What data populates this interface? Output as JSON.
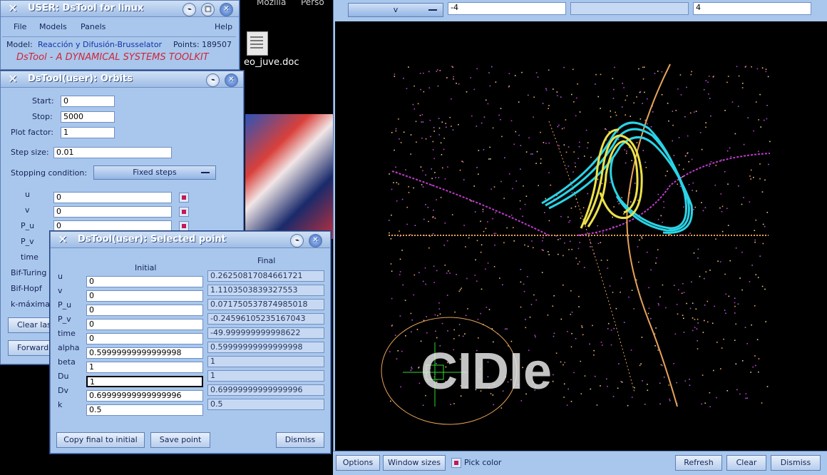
{
  "colors": {
    "window_bg": "#a9c7ec",
    "plot_bg": "#000000",
    "orbit_cyan": "#2ad4e6",
    "orbit_yellow": "#ece14a",
    "orbit_magenta": "#c23ad0",
    "orbit_orange": "#e8a35a"
  },
  "desktop": {
    "topbar_items": [
      "Mozilla",
      "Perso"
    ],
    "file_label": "eo_juve.doc",
    "logo_text": "CIDIe"
  },
  "main_window": {
    "title": "USER: DsTool for linux",
    "menu": [
      "File",
      "Models",
      "Panels",
      "Help"
    ],
    "model_label": "Model:",
    "model_value": "Reacción y Difusión-Brusselator",
    "points_label": "Points:",
    "points_value": "189507",
    "banner": "DsTool - A DYNAMICAL SYSTEMS TOOLKIT"
  },
  "orbits_window": {
    "title": "DsTool(user): Orbits",
    "start_label": "Start:",
    "start_value": "0",
    "stop_label": "Stop:",
    "stop_value": "5000",
    "plot_factor_label": "Plot factor:",
    "plot_factor_value": "1",
    "step_size_label": "Step size:",
    "step_size_value": "0.01",
    "stopping_label": "Stopping condition:",
    "stopping_value": "Fixed steps",
    "vars": [
      {
        "label": "u",
        "value": "0"
      },
      {
        "label": "v",
        "value": "0"
      },
      {
        "label": "P_u",
        "value": "0"
      },
      {
        "label": "P_v",
        "value": ""
      },
      {
        "label": "time",
        "value": ""
      }
    ],
    "extra_labels": [
      "Bif-Turing",
      "Bif-Hopf",
      "k-máxima"
    ],
    "buttons": [
      "Clear las",
      "Forward"
    ]
  },
  "selected_point_window": {
    "title": "DsTool(user): Selected point",
    "initial_header": "Initial",
    "final_header": "Final",
    "rows": [
      {
        "label": "u",
        "initial": "0",
        "final": "0.26250817084661721"
      },
      {
        "label": "v",
        "initial": "0",
        "final": "1.1103503839327553"
      },
      {
        "label": "P_u",
        "initial": "0",
        "final": "0.071750537874985018"
      },
      {
        "label": "P_v",
        "initial": "0",
        "final": "-0.24596105235167043"
      },
      {
        "label": "time",
        "initial": "0",
        "final": "-49.999999999998622"
      },
      {
        "label": "alpha",
        "initial": "0.59999999999999998",
        "final": "0.59999999999999998"
      },
      {
        "label": "beta",
        "initial": "1",
        "final": "1"
      },
      {
        "label": "Du",
        "initial": "1",
        "final": "1"
      },
      {
        "label": "Dv",
        "initial": "0.69999999999999996",
        "final": "0.69999999999999996"
      },
      {
        "label": "k",
        "initial": "0.5",
        "final": "0.5"
      }
    ],
    "buttons": {
      "copy": "Copy final to initial",
      "save": "Save point",
      "dismiss": "Dismiss"
    }
  },
  "plot_window": {
    "axis_select": "v",
    "min_value": "-4",
    "max_value": "4",
    "bottom_buttons": {
      "options": "Options",
      "window_sizes": "Window sizes",
      "pick_color": "Pick color",
      "refresh": "Refresh",
      "clear": "Clear",
      "dismiss": "Dismiss"
    }
  }
}
